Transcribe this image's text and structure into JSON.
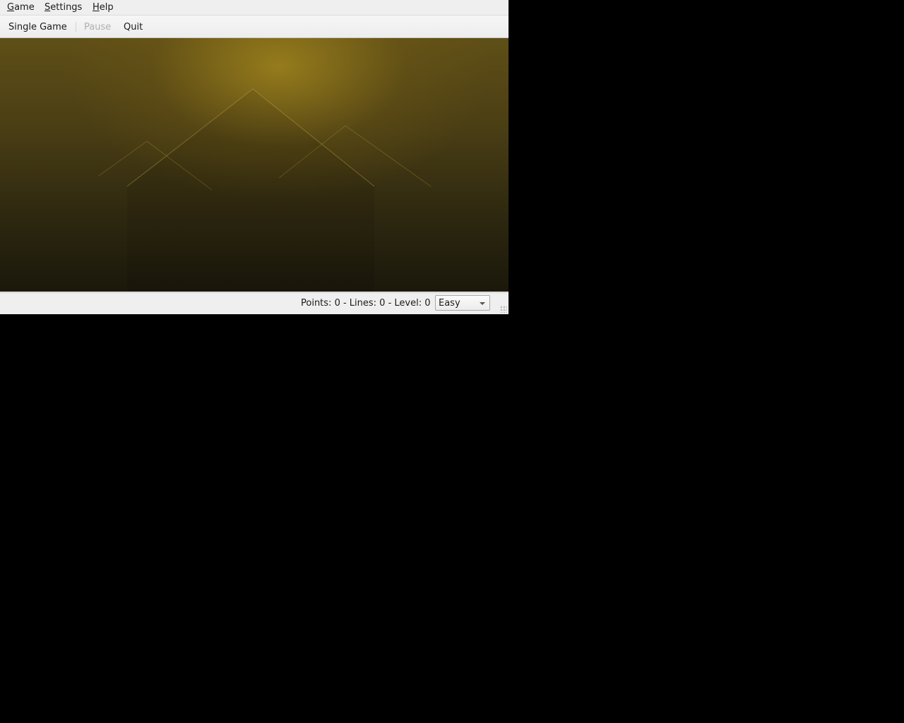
{
  "menubar": {
    "items": [
      {
        "mnemonic": "G",
        "rest": "ame"
      },
      {
        "mnemonic": "S",
        "rest": "ettings"
      },
      {
        "mnemonic": "H",
        "rest": "elp"
      }
    ]
  },
  "toolbar": {
    "single_game_label": "Single Game",
    "pause_label": "Pause",
    "quit_label": "Quit"
  },
  "status": {
    "text": "Points: 0 - Lines: 0 - Level: 0",
    "level_selected": "Easy"
  },
  "colors": {
    "desktop_background": "#000000",
    "window_background": "#efefef",
    "game_background_glow": "#aa8c1e",
    "disabled_text": "#b0b0b0"
  }
}
